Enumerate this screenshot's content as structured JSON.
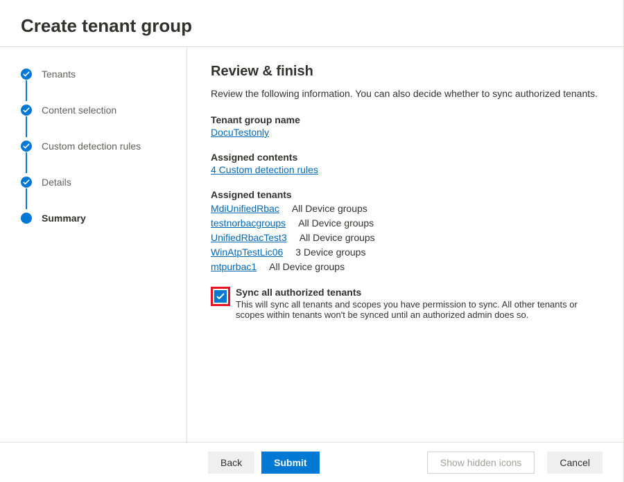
{
  "header": {
    "title": "Create tenant group"
  },
  "sidebar": {
    "steps": [
      {
        "label": "Tenants",
        "done": true
      },
      {
        "label": "Content selection",
        "done": true
      },
      {
        "label": "Custom detection rules",
        "done": true
      },
      {
        "label": "Details",
        "done": true
      },
      {
        "label": "Summary",
        "current": true
      }
    ]
  },
  "main": {
    "heading": "Review & finish",
    "description": "Review the following information. You can also decide whether to sync authorized tenants.",
    "tenant_group_label": "Tenant group name",
    "tenant_group_value": "DocuTestonly",
    "assigned_contents_label": "Assigned contents",
    "assigned_contents_value": "4 Custom detection rules",
    "assigned_tenants_label": "Assigned tenants",
    "tenants": [
      {
        "name": "MdiUnifiedRbac",
        "scope": "All Device groups"
      },
      {
        "name": "testnorbacgroups",
        "scope": "All Device groups"
      },
      {
        "name": "UnifiedRbacTest3",
        "scope": "All Device groups"
      },
      {
        "name": "WinAtpTestLic06",
        "scope": "3 Device groups"
      },
      {
        "name": "mtpurbac1",
        "scope": "All Device groups"
      }
    ],
    "sync_checkbox": {
      "label": "Sync all authorized tenants",
      "description": "This will sync all tenants and scopes you have permission to sync. All other tenants or scopes within tenants won't be synced until an authorized admin does so.",
      "checked": true
    }
  },
  "footer": {
    "back": "Back",
    "submit": "Submit",
    "hidden_icons": "Show hidden icons",
    "cancel": "Cancel"
  }
}
